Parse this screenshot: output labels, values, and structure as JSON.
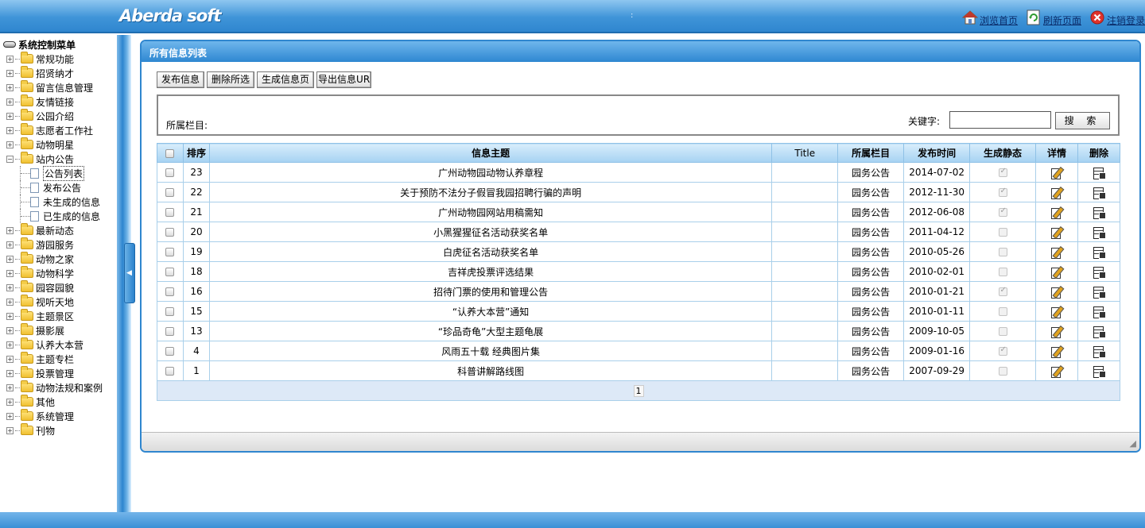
{
  "header": {
    "logo": "Aberda soft",
    "dot": ":",
    "links": {
      "home": "浏览首页",
      "refresh": "刷新页面",
      "logout": "注销登录"
    }
  },
  "sidebar": {
    "root": "系统控制菜单",
    "items": [
      {
        "label": "常规功能",
        "expanded": false
      },
      {
        "label": "招贤纳才",
        "expanded": false
      },
      {
        "label": "留言信息管理",
        "expanded": false
      },
      {
        "label": "友情链接",
        "expanded": false
      },
      {
        "label": "公园介绍",
        "expanded": false
      },
      {
        "label": "志愿者工作社",
        "expanded": false
      },
      {
        "label": "动物明星",
        "expanded": false
      },
      {
        "label": "站内公告",
        "expanded": true
      },
      {
        "label": "最新动态",
        "expanded": false
      },
      {
        "label": "游园服务",
        "expanded": false
      },
      {
        "label": "动物之家",
        "expanded": false
      },
      {
        "label": "动物科学",
        "expanded": false
      },
      {
        "label": "园容园貌",
        "expanded": false
      },
      {
        "label": "视听天地",
        "expanded": false
      },
      {
        "label": "主题景区",
        "expanded": false
      },
      {
        "label": "摄影展",
        "expanded": false
      },
      {
        "label": "认养大本营",
        "expanded": false
      },
      {
        "label": "主题专栏",
        "expanded": false
      },
      {
        "label": "投票管理",
        "expanded": false
      },
      {
        "label": "动物法规和案例",
        "expanded": false
      },
      {
        "label": "其他",
        "expanded": false
      },
      {
        "label": "系统管理",
        "expanded": false
      },
      {
        "label": "刊物",
        "expanded": false
      }
    ],
    "sub_items": [
      "公告列表",
      "发布公告",
      "未生成的信息",
      "已生成的信息"
    ],
    "selected_sub": "公告列表"
  },
  "panel": {
    "title": "所有信息列表",
    "toolbar": [
      "发布信息",
      "删除所选",
      "生成信息页",
      "导出信息UR"
    ],
    "filter": {
      "category_label": "所属栏目:",
      "keyword_label": "关键字:",
      "keyword_value": "",
      "search_label": "搜 索"
    },
    "columns": [
      "",
      "排序",
      "信息主题",
      "Title",
      "所属栏目",
      "发布时间",
      "生成静态",
      "详情",
      "删除"
    ],
    "rows": [
      {
        "order": "23",
        "subject": "广州动物园动物认养章程",
        "title": "",
        "category": "园务公告",
        "date": "2014-07-02",
        "static": true
      },
      {
        "order": "22",
        "subject": "关于预防不法分子假冒我园招聘行骗的声明",
        "title": "",
        "category": "园务公告",
        "date": "2012-11-30",
        "static": true
      },
      {
        "order": "21",
        "subject": "广州动物园网站用稿需知",
        "title": "",
        "category": "园务公告",
        "date": "2012-06-08",
        "static": true
      },
      {
        "order": "20",
        "subject": "小黑猩猩征名活动获奖名单",
        "title": "",
        "category": "园务公告",
        "date": "2011-04-12",
        "static": false
      },
      {
        "order": "19",
        "subject": "白虎征名活动获奖名单",
        "title": "",
        "category": "园务公告",
        "date": "2010-05-26",
        "static": false
      },
      {
        "order": "18",
        "subject": "吉祥虎投票评选结果",
        "title": "",
        "category": "园务公告",
        "date": "2010-02-01",
        "static": false
      },
      {
        "order": "16",
        "subject": "招待门票的使用和管理公告",
        "title": "",
        "category": "园务公告",
        "date": "2010-01-21",
        "static": true
      },
      {
        "order": "15",
        "subject": "“认养大本营”通知",
        "title": "",
        "category": "园务公告",
        "date": "2010-01-11",
        "static": false
      },
      {
        "order": "13",
        "subject": "“珍品奇龟”大型主题龟展",
        "title": "",
        "category": "园务公告",
        "date": "2009-10-05",
        "static": false
      },
      {
        "order": "4",
        "subject": "风雨五十载 经典图片集",
        "title": "",
        "category": "园务公告",
        "date": "2009-01-16",
        "static": true
      },
      {
        "order": "1",
        "subject": "科普讲解路线图",
        "title": "",
        "category": "园务公告",
        "date": "2007-09-29",
        "static": false
      }
    ],
    "pager": {
      "current": "1"
    }
  }
}
